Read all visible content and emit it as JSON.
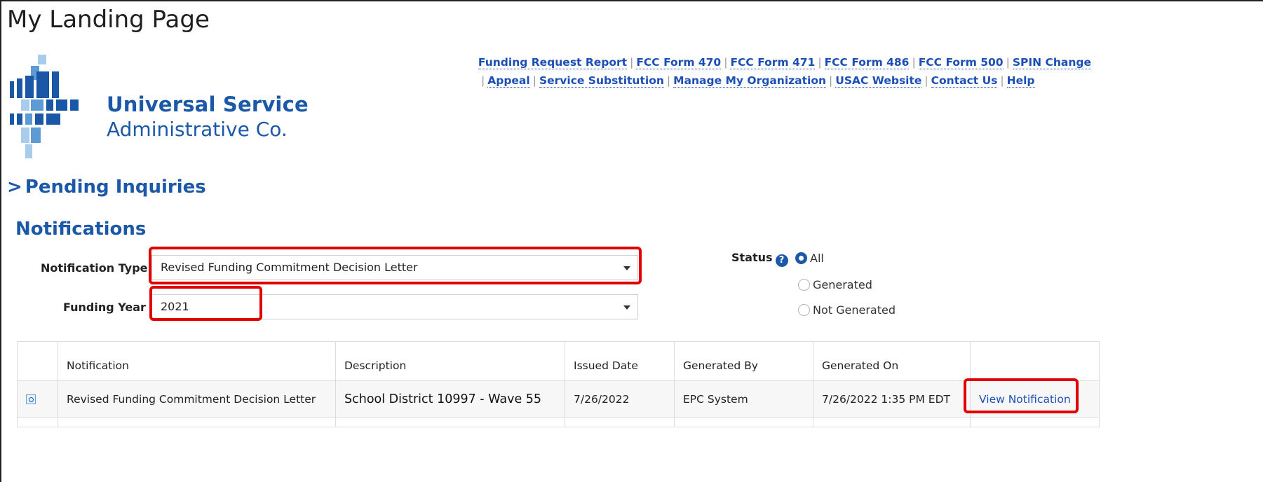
{
  "page": {
    "title": "My Landing Page"
  },
  "logo": {
    "line1": "Universal Service",
    "line2": "Administrative Co."
  },
  "nav_links": {
    "row1": [
      "Funding Request Report",
      "FCC Form 470",
      "FCC Form 471",
      "FCC Form 486",
      "FCC Form 500",
      "SPIN Change"
    ],
    "row2": [
      "Appeal",
      "Service Substitution",
      "Manage My Organization",
      "USAC Website",
      "Contact Us",
      "Help"
    ],
    "separator": "|"
  },
  "pending": {
    "chevron": ">",
    "label": "Pending Inquiries"
  },
  "notifications": {
    "heading": "Notifications",
    "type_label": "Notification Type",
    "type_value": "Revised Funding Commitment Decision Letter",
    "year_label": "Funding Year",
    "year_value": "2021",
    "status_label": "Status",
    "status_help": "?",
    "status_options": [
      "All",
      "Generated",
      "Not Generated"
    ],
    "status_selected": "All"
  },
  "table": {
    "headers": [
      "",
      "Notification",
      "Description",
      "Issued Date",
      "Generated By",
      "Generated On",
      ""
    ],
    "rows": [
      {
        "icon": "preview-icon",
        "notification": "Revised Funding Commitment Decision Letter",
        "description": "School District 10997 - Wave 55",
        "issued_date": "7/26/2022",
        "generated_by": "EPC System",
        "generated_on": "7/26/2022 1:35 PM EDT",
        "action": "View Notification"
      }
    ]
  },
  "colors": {
    "brand_blue": "#1b59a8",
    "link_blue": "#1c4fb6",
    "highlight_red": "#e00000"
  }
}
